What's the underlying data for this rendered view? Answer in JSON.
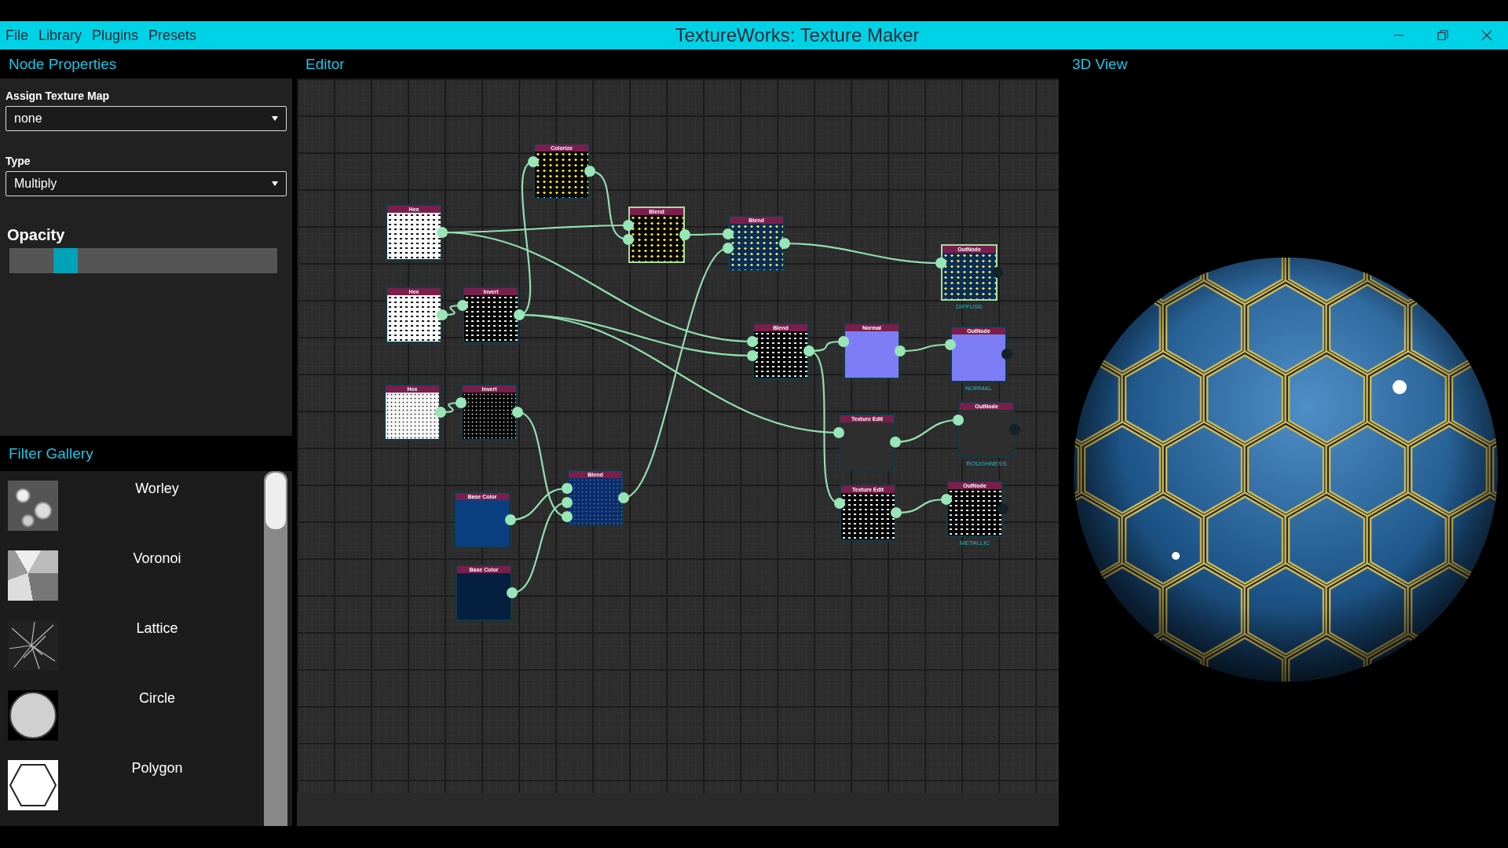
{
  "window": {
    "title": "TextureWorks: Texture Maker"
  },
  "menu": [
    "File",
    "Library",
    "Plugins",
    "Presets"
  ],
  "panels": {
    "properties": "Node Properties",
    "editor": "Editor",
    "view": "3D View",
    "gallery": "Filter Gallery"
  },
  "properties": {
    "assign_texture_map": {
      "label": "Assign Texture Map",
      "value": "none"
    },
    "type": {
      "label": "Type",
      "value": "Multiply"
    },
    "opacity": {
      "label": "Opacity",
      "level": 0.18
    }
  },
  "nodes": [
    {
      "title": "Hex",
      "kind": "hex-white",
      "selected": false
    },
    {
      "title": "Hex",
      "kind": "hex-white",
      "selected": false
    },
    {
      "title": "Invert",
      "kind": "hex-black",
      "selected": false
    },
    {
      "title": "Hex",
      "kind": "dots-white",
      "selected": false
    },
    {
      "title": "Invert",
      "kind": "dots-black",
      "selected": false
    },
    {
      "title": "Colorize",
      "kind": "hex-yellow",
      "selected": false
    },
    {
      "title": "Blend",
      "kind": "hex-yellow",
      "selected": true
    },
    {
      "title": "Blend",
      "kind": "hex-blue",
      "selected": false
    },
    {
      "title": "OutNode",
      "kind": "hex-blue",
      "selected": true,
      "caption": "DIFFUSE"
    },
    {
      "title": "Blend",
      "kind": "hex-black",
      "selected": false
    },
    {
      "title": "Normal",
      "kind": "normal",
      "selected": false
    },
    {
      "title": "OutNode",
      "kind": "normal",
      "selected": false,
      "caption": "NORMAL"
    },
    {
      "title": "Texture Edit",
      "kind": "dark",
      "selected": false
    },
    {
      "title": "OutNode",
      "kind": "dark",
      "selected": false,
      "caption": "ROUGHNESS"
    },
    {
      "title": "Texture Edit",
      "kind": "hex-black",
      "selected": false
    },
    {
      "title": "OutNode",
      "kind": "hex-black",
      "selected": false,
      "caption": "METALLIC"
    },
    {
      "title": "Base Color",
      "kind": "base-blue",
      "selected": false
    },
    {
      "title": "Base Color",
      "kind": "base-navy",
      "selected": false
    },
    {
      "title": "Blend",
      "kind": "dots-blue",
      "selected": false
    }
  ],
  "gallery": [
    {
      "name": "Worley",
      "kind": "worley"
    },
    {
      "name": "Voronoi",
      "kind": "voronoi"
    },
    {
      "name": "Lattice",
      "kind": "lattice"
    },
    {
      "name": "Circle",
      "kind": "circle"
    },
    {
      "name": "Polygon",
      "kind": "polygon"
    }
  ]
}
